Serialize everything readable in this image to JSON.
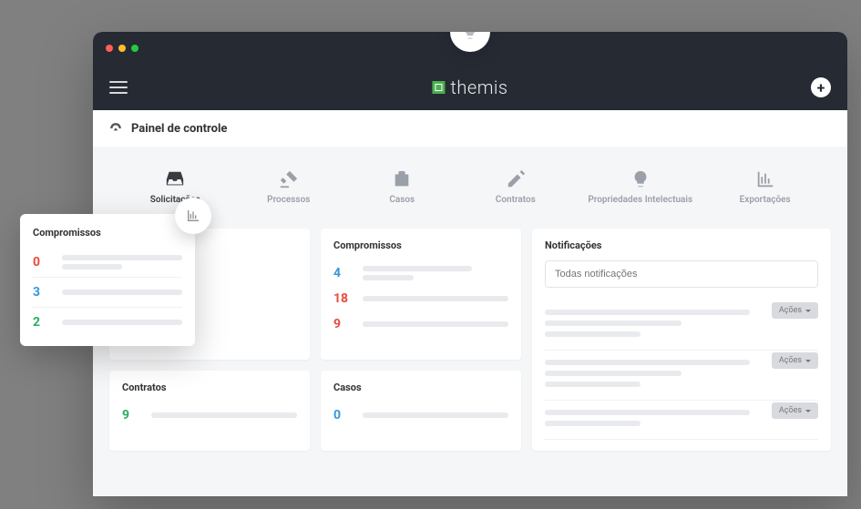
{
  "brand": {
    "name": "themis"
  },
  "breadcrumb": {
    "title": "Painel de controle"
  },
  "quicklinks": [
    {
      "label": "Solicitações",
      "icon": "inbox",
      "active": true
    },
    {
      "label": "Processos",
      "icon": "gavel",
      "active": false
    },
    {
      "label": "Casos",
      "icon": "briefcase",
      "active": false
    },
    {
      "label": "Contratos",
      "icon": "pencil",
      "active": false
    },
    {
      "label": "Propriedades Intelectuais",
      "icon": "bulb",
      "active": false
    },
    {
      "label": "Exportações",
      "icon": "chart",
      "active": false
    }
  ],
  "float_compromissos": {
    "title": "Compromissos",
    "items": [
      {
        "value": 0,
        "color": "red"
      },
      {
        "value": 3,
        "color": "blue"
      },
      {
        "value": 2,
        "color": "green"
      }
    ]
  },
  "compromissos": {
    "title": "Compromissos",
    "items": [
      {
        "value": 4,
        "color": "blue"
      },
      {
        "value": 18,
        "color": "red"
      },
      {
        "value": 9,
        "color": "red"
      }
    ]
  },
  "contratos": {
    "title": "Contratos",
    "value": 9,
    "color": "green"
  },
  "casos": {
    "title": "Casos",
    "value": 0,
    "color": "blue"
  },
  "notificacoes": {
    "title": "Notificações",
    "placeholder": "Todas notificações",
    "action_label": "Ações",
    "items": [
      {},
      {},
      {}
    ]
  }
}
